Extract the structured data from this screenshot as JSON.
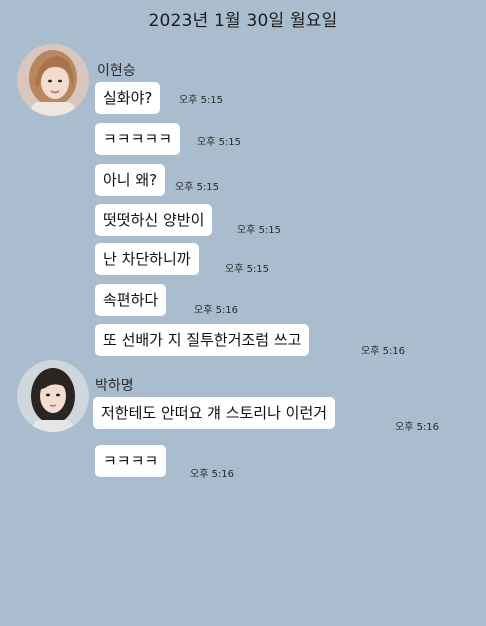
{
  "date_header": "2023년 1월 30일 월요일",
  "senders": [
    {
      "name": "이현승",
      "avatar_icon": "profile-photo"
    },
    {
      "name": "박하명",
      "avatar_icon": "profile-photo"
    }
  ],
  "messages": [
    {
      "sender": "이현승",
      "text": "실화야?",
      "time": "오후 5:15"
    },
    {
      "sender": "이현승",
      "text": "ㅋㅋㅋㅋㅋ",
      "time": "오후 5:15"
    },
    {
      "sender": "이현승",
      "text": "아니 왜?",
      "time": "오후 5:15"
    },
    {
      "sender": "이현승",
      "text": "떳떳하신 양반이",
      "time": "오후 5:15"
    },
    {
      "sender": "이현승",
      "text": "난 차단하니까",
      "time": "오후 5:15"
    },
    {
      "sender": "이현승",
      "text": "속편하다",
      "time": "오후 5:16"
    },
    {
      "sender": "이현승",
      "text": "또 선배가 지 질투한거조럼 쓰고",
      "time": "오후 5:16"
    },
    {
      "sender": "박하명",
      "text": "저한테도 안떠요 걔 스토리나 이런거",
      "time": "오후 5:16"
    },
    {
      "sender": "박하명",
      "text": "ㅋㅋㅋㅋ",
      "time": "오후 5:16"
    }
  ],
  "colors": {
    "background": "#a9bdce",
    "bubble": "#ffffff"
  }
}
